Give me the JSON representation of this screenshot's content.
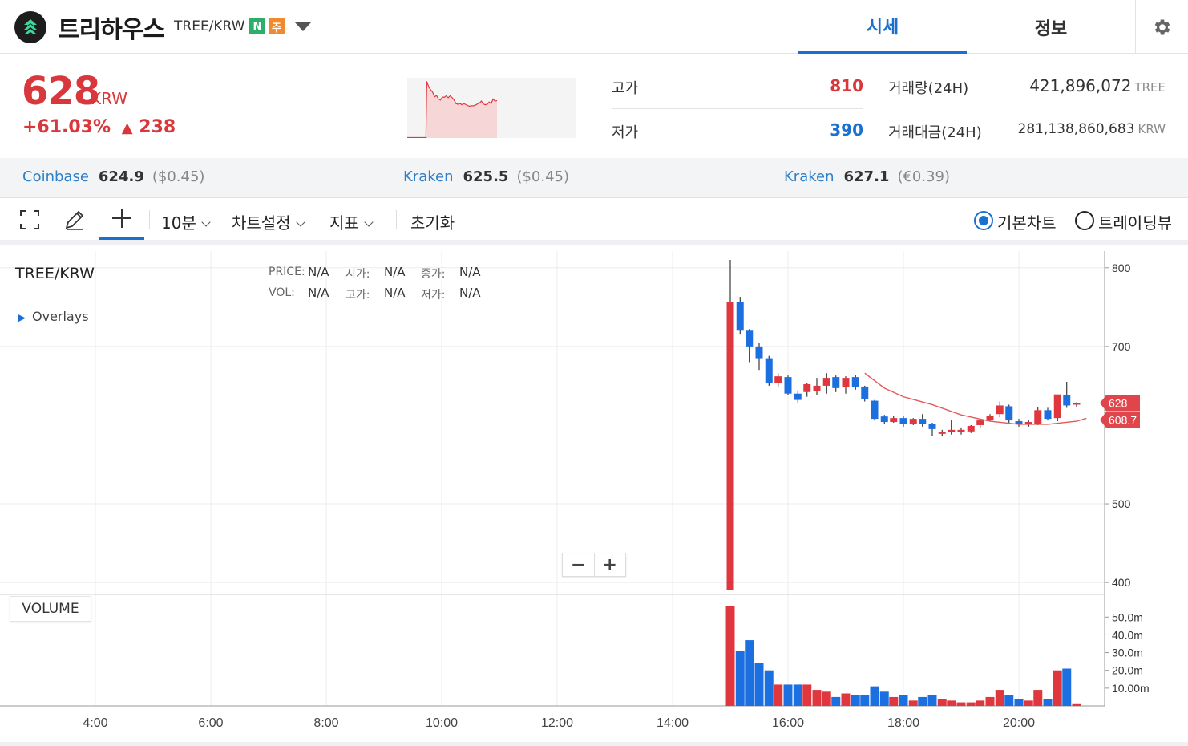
{
  "header": {
    "coin_name": "트리하우스",
    "pair_code": "TREE/KRW",
    "badge_n": "N",
    "badge_j": "주",
    "tabs": [
      {
        "label": "시세"
      },
      {
        "label": "정보"
      }
    ],
    "active_tab": "시세"
  },
  "summary": {
    "price": "628",
    "unit": "KRW",
    "change_pct": "+61.03%",
    "change_arrow": "▲",
    "change_abs": "238",
    "high_label": "고가",
    "high_value": "810",
    "low_label": "저가",
    "low_value": "390",
    "volume_label": "거래량(24H)",
    "volume_value": "421,896,072",
    "volume_unit": "TREE",
    "turnover_label": "거래대금(24H)",
    "turnover_value": "281,138,860,683",
    "turnover_unit": "KRW"
  },
  "exchanges": [
    {
      "name": "Coinbase",
      "price": "624.9",
      "sub": "($0.45)"
    },
    {
      "name": "Kraken",
      "price": "625.5",
      "sub": "($0.45)"
    },
    {
      "name": "Kraken",
      "price": "627.1",
      "sub": "(€0.39)"
    }
  ],
  "toolbar": {
    "interval": "10분",
    "chart_settings": "차트설정",
    "indicators": "지표",
    "reset": "초기화",
    "basic_chart": "기본차트",
    "tradingview": "트레이딩뷰"
  },
  "chart_legend": {
    "symbol": "TREE/KRW",
    "overlays": "Overlays",
    "price_key": "PRICE:",
    "price_val": "N/A",
    "open_key": "시가:",
    "open_val": "N/A",
    "close_key": "종가:",
    "close_val": "N/A",
    "vol_key": "VOL:",
    "vol_val": "N/A",
    "high_key": "고가:",
    "high_val": "N/A",
    "low_key": "저가:",
    "low_val": "N/A",
    "volume_button": "VOLUME",
    "zoom_out": "−",
    "zoom_in": "+"
  },
  "colors": {
    "up": "#e0373f",
    "down": "#1b6fe0",
    "accent": "#1a6fd0",
    "ma": "#e25a5a"
  },
  "chart_data": {
    "type": "candlestick",
    "interval": "10분",
    "y_ticks": [
      800,
      700,
      500,
      400
    ],
    "ylim": [
      393,
      811
    ],
    "volume_ticks": [
      "50.0m",
      "40.0m",
      "30.0m",
      "20.0m",
      "10.00m"
    ],
    "volume_tick_values": [
      50,
      40,
      30,
      20,
      10
    ],
    "x_ticks": [
      "4:00",
      "6:00",
      "8:00",
      "10:00",
      "12:00",
      "14:00",
      "16:00",
      "18:00",
      "20:00"
    ],
    "x_tick_hours": [
      4,
      6,
      8,
      10,
      12,
      14,
      16,
      18,
      20
    ],
    "current_price": 628,
    "current_price_label": "628",
    "ma_value": 608.7,
    "ma_label": "608.7",
    "candles": [
      {
        "t": 15.0,
        "o": 390,
        "h": 810,
        "l": 390,
        "c": 756,
        "v": 56
      },
      {
        "t": 15.17,
        "o": 756,
        "h": 763,
        "l": 715,
        "c": 720,
        "v": 31
      },
      {
        "t": 15.33,
        "o": 720,
        "h": 722,
        "l": 680,
        "c": 700,
        "v": 37
      },
      {
        "t": 15.5,
        "o": 700,
        "h": 705,
        "l": 670,
        "c": 685,
        "v": 24
      },
      {
        "t": 15.67,
        "o": 685,
        "h": 688,
        "l": 650,
        "c": 653,
        "v": 20
      },
      {
        "t": 15.83,
        "o": 653,
        "h": 666,
        "l": 648,
        "c": 662,
        "v": 12
      },
      {
        "t": 16.0,
        "o": 661,
        "h": 663,
        "l": 638,
        "c": 640,
        "v": 12
      },
      {
        "t": 16.17,
        "o": 640,
        "h": 643,
        "l": 628,
        "c": 632,
        "v": 12
      },
      {
        "t": 16.33,
        "o": 642,
        "h": 654,
        "l": 636,
        "c": 652,
        "v": 12
      },
      {
        "t": 16.5,
        "o": 643,
        "h": 660,
        "l": 638,
        "c": 650,
        "v": 9
      },
      {
        "t": 16.67,
        "o": 650,
        "h": 666,
        "l": 640,
        "c": 660,
        "v": 8
      },
      {
        "t": 16.83,
        "o": 661,
        "h": 663,
        "l": 642,
        "c": 647,
        "v": 5
      },
      {
        "t": 17.0,
        "o": 648,
        "h": 662,
        "l": 640,
        "c": 660,
        "v": 7
      },
      {
        "t": 17.17,
        "o": 661,
        "h": 664,
        "l": 645,
        "c": 648,
        "v": 6
      },
      {
        "t": 17.33,
        "o": 649,
        "h": 650,
        "l": 630,
        "c": 633,
        "v": 6
      },
      {
        "t": 17.5,
        "o": 631,
        "h": 632,
        "l": 606,
        "c": 608,
        "v": 11
      },
      {
        "t": 17.67,
        "o": 611,
        "h": 613,
        "l": 602,
        "c": 604,
        "v": 8
      },
      {
        "t": 17.83,
        "o": 604,
        "h": 612,
        "l": 603,
        "c": 609,
        "v": 5
      },
      {
        "t": 18.0,
        "o": 609,
        "h": 611,
        "l": 598,
        "c": 601,
        "v": 6
      },
      {
        "t": 18.17,
        "o": 601,
        "h": 609,
        "l": 600,
        "c": 608,
        "v": 3
      },
      {
        "t": 18.33,
        "o": 608,
        "h": 614,
        "l": 598,
        "c": 602,
        "v": 5
      },
      {
        "t": 18.5,
        "o": 602,
        "h": 603,
        "l": 586,
        "c": 595,
        "v": 6
      },
      {
        "t": 18.67,
        "o": 591,
        "h": 594,
        "l": 586,
        "c": 591,
        "v": 4
      },
      {
        "t": 18.83,
        "o": 591,
        "h": 606,
        "l": 588,
        "c": 594,
        "v": 3
      },
      {
        "t": 19.0,
        "o": 591,
        "h": 597,
        "l": 588,
        "c": 594,
        "v": 2
      },
      {
        "t": 19.17,
        "o": 592,
        "h": 600,
        "l": 590,
        "c": 599,
        "v": 2
      },
      {
        "t": 19.33,
        "o": 600,
        "h": 606,
        "l": 596,
        "c": 606,
        "v": 3
      },
      {
        "t": 19.5,
        "o": 606,
        "h": 614,
        "l": 605,
        "c": 612,
        "v": 5
      },
      {
        "t": 19.67,
        "o": 614,
        "h": 630,
        "l": 610,
        "c": 625,
        "v": 9
      },
      {
        "t": 19.83,
        "o": 624,
        "h": 626,
        "l": 603,
        "c": 606,
        "v": 6
      },
      {
        "t": 20.0,
        "o": 605,
        "h": 608,
        "l": 598,
        "c": 601,
        "v": 4
      },
      {
        "t": 20.17,
        "o": 601,
        "h": 606,
        "l": 598,
        "c": 604,
        "v": 3
      },
      {
        "t": 20.33,
        "o": 602,
        "h": 623,
        "l": 600,
        "c": 619,
        "v": 9
      },
      {
        "t": 20.5,
        "o": 619,
        "h": 622,
        "l": 606,
        "c": 608,
        "v": 4
      },
      {
        "t": 20.67,
        "o": 609,
        "h": 622,
        "l": 605,
        "c": 639,
        "v": 20
      },
      {
        "t": 20.83,
        "o": 638,
        "h": 655,
        "l": 622,
        "c": 625,
        "v": 21
      },
      {
        "t": 21.0,
        "o": 626,
        "h": 629,
        "l": 623,
        "c": 628,
        "v": 1
      }
    ],
    "ma_points": [
      {
        "t": 17.33,
        "v": 666
      },
      {
        "t": 17.67,
        "v": 647
      },
      {
        "t": 18.0,
        "v": 636
      },
      {
        "t": 18.5,
        "v": 626
      },
      {
        "t": 19.0,
        "v": 613
      },
      {
        "t": 19.5,
        "v": 605
      },
      {
        "t": 20.0,
        "v": 601
      },
      {
        "t": 20.5,
        "v": 601
      },
      {
        "t": 21.0,
        "v": 605
      },
      {
        "t": 21.17,
        "v": 608.7
      }
    ],
    "sparkline": [
      null,
      null,
      null,
      null,
      null,
      null,
      null,
      null,
      null,
      null,
      756,
      720,
      700,
      685,
      653,
      662,
      640,
      632,
      652,
      650,
      660,
      647,
      660,
      648,
      633,
      608,
      604,
      609,
      601,
      608,
      602,
      595,
      591,
      594,
      594,
      599,
      606,
      612,
      625,
      606,
      601,
      604,
      619,
      608,
      639,
      625,
      628
    ]
  }
}
